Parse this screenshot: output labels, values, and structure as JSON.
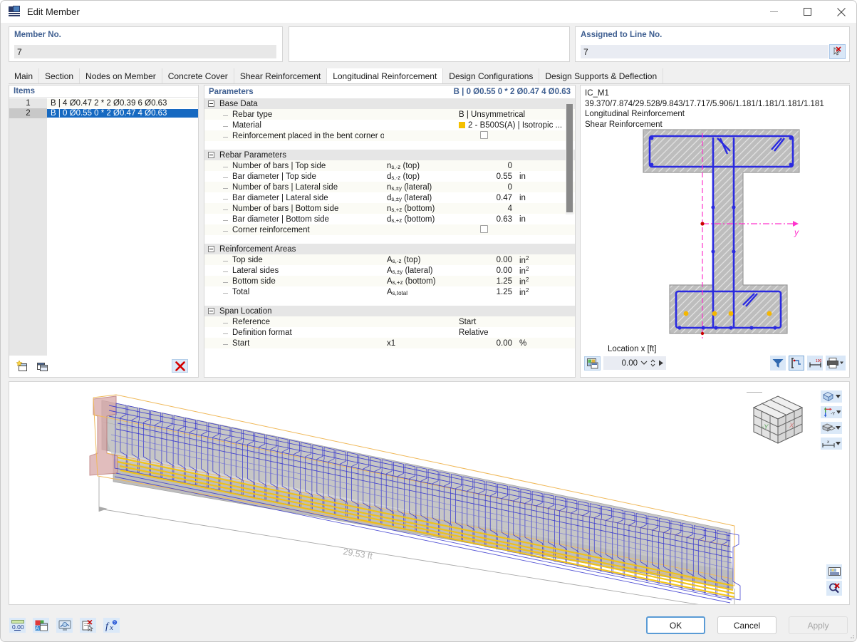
{
  "window": {
    "title": "Edit Member",
    "icon": "member-icon",
    "controls": {
      "minimize": "minimize-icon",
      "maximize": "maximize-icon",
      "close": "close-icon"
    }
  },
  "header": {
    "member": {
      "label": "Member No.",
      "value": "7"
    },
    "middle": {
      "label": "",
      "value": ""
    },
    "line": {
      "label": "Assigned to Line No.",
      "value": "7",
      "pick_icon": "pick-line-icon"
    }
  },
  "tabs": [
    {
      "label": "Main",
      "active": false
    },
    {
      "label": "Section",
      "active": false
    },
    {
      "label": "Nodes on Member",
      "active": false
    },
    {
      "label": "Concrete Cover",
      "active": false
    },
    {
      "label": "Shear Reinforcement",
      "active": false
    },
    {
      "label": "Longitudinal Reinforcement",
      "active": true
    },
    {
      "label": "Design Configurations",
      "active": false
    },
    {
      "label": "Design Supports & Deflection",
      "active": false
    }
  ],
  "items": {
    "header": "Items",
    "rows": [
      {
        "no": "1",
        "text": "B | 4 Ø0.47 2 * 2 Ø0.39 6 Ø0.63",
        "selected": false
      },
      {
        "no": "2",
        "text": "B | 0 Ø0.55 0 * 2 Ø0.47 4 Ø0.63",
        "selected": true
      }
    ],
    "toolbar": {
      "new_icon": "new-item-icon",
      "copy_icon": "copy-item-icon",
      "delete_icon": "delete-item-icon"
    }
  },
  "parameters": {
    "header": "Parameters",
    "header_value": "B | 0 Ø0.55 0 * 2 Ø0.47 4 Ø0.63",
    "groups": [
      {
        "name": "Base Data",
        "rows": [
          {
            "label": "Rebar type",
            "symbol": "",
            "value": "B | Unsymmetrical",
            "unit": "",
            "kind": "text-wide"
          },
          {
            "label": "Material",
            "symbol": "",
            "value": "2 - B500S(A) | Isotropic ...",
            "unit": "",
            "kind": "material",
            "swatch": "#f5c000"
          },
          {
            "label": "Reinforcement placed in the bent corner of t...",
            "symbol": "",
            "value": "",
            "unit": "",
            "kind": "checkbox",
            "checked": false
          }
        ]
      },
      {
        "name": "Rebar Parameters",
        "rows": [
          {
            "label": "Number of bars | Top side",
            "symbol": "n_s,-z (top)",
            "value": "0",
            "unit": "",
            "kind": "number"
          },
          {
            "label": "Bar diameter | Top side",
            "symbol": "d_s,-z (top)",
            "value": "0.55",
            "unit": "in",
            "kind": "number"
          },
          {
            "label": "Number of bars | Lateral side",
            "symbol": "n_s,±y (lateral)",
            "value": "0",
            "unit": "",
            "kind": "number"
          },
          {
            "label": "Bar diameter | Lateral side",
            "symbol": "d_s,±y (lateral)",
            "value": "0.47",
            "unit": "in",
            "kind": "number"
          },
          {
            "label": "Number of bars | Bottom side",
            "symbol": "n_s,+z (bottom)",
            "value": "4",
            "unit": "",
            "kind": "number"
          },
          {
            "label": "Bar diameter | Bottom side",
            "symbol": "d_s,+z (bottom)",
            "value": "0.63",
            "unit": "in",
            "kind": "number"
          },
          {
            "label": "Corner reinforcement",
            "symbol": "",
            "value": "",
            "unit": "",
            "kind": "checkbox",
            "checked": false
          }
        ]
      },
      {
        "name": "Reinforcement Areas",
        "rows": [
          {
            "label": "Top side",
            "symbol": "A_s,-z (top)",
            "value": "0.00",
            "unit": "in2",
            "kind": "number"
          },
          {
            "label": "Lateral sides",
            "symbol": "A_s,±y (lateral)",
            "value": "0.00",
            "unit": "in2",
            "kind": "number"
          },
          {
            "label": "Bottom side",
            "symbol": "A_s,+z (bottom)",
            "value": "1.25",
            "unit": "in2",
            "kind": "number"
          },
          {
            "label": "Total",
            "symbol": "A_s,total",
            "value": "1.25",
            "unit": "in2",
            "kind": "number"
          }
        ]
      },
      {
        "name": "Span Location",
        "rows": [
          {
            "label": "Reference",
            "symbol": "",
            "value": "Start",
            "unit": "",
            "kind": "text-wide"
          },
          {
            "label": "Definition format",
            "symbol": "",
            "value": "Relative",
            "unit": "",
            "kind": "text-wide"
          },
          {
            "label": "Start",
            "symbol": "x1",
            "value": "0.00",
            "unit": "%",
            "kind": "number"
          }
        ]
      }
    ]
  },
  "section_view": {
    "info_lines": [
      "IC_M1 39.370/7.874/29.528/9.843/17.717/5.906/1.181/1.181/1.181/1.181",
      "Longitudinal Reinforcement",
      "Shear Reinforcement"
    ],
    "axis_label": "y",
    "location": {
      "label": "Location x [ft]",
      "value": "0.00"
    },
    "buttons": {
      "image_icon": "save-image-icon",
      "filter_icon": "filter-icon",
      "section_icon": "section-properties-icon",
      "dimensions_icon": "dimensions-icon",
      "print_icon": "print-icon"
    }
  },
  "viewport": {
    "dimension_label": "29.53 ft",
    "navcube": {
      "face_left": "-Y",
      "face_right": "X"
    },
    "tools": [
      {
        "name": "render-mode-button",
        "icon": "cube-icon"
      },
      {
        "name": "axes-button",
        "icon": "axes-icon",
        "label": "-Y"
      },
      {
        "name": "view-layers-button",
        "icon": "layers-icon"
      },
      {
        "name": "dimension-button",
        "icon": "dimension-icon"
      }
    ],
    "bottom_tools": [
      {
        "name": "print-view-button",
        "icon": "print-view-icon"
      },
      {
        "name": "clear-selection-button",
        "icon": "clear-zoom-icon"
      }
    ]
  },
  "footer": {
    "tools": [
      {
        "name": "decimals-button",
        "icon": "decimal-places-icon"
      },
      {
        "name": "display-properties-button",
        "icon": "display-properties-icon"
      },
      {
        "name": "render-settings-button",
        "icon": "render-settings-icon"
      },
      {
        "name": "reset-button",
        "icon": "reset-selection-icon"
      },
      {
        "name": "formula-button",
        "icon": "formula-icon"
      }
    ],
    "buttons": {
      "ok": "OK",
      "cancel": "Cancel",
      "apply": "Apply"
    }
  },
  "colors": {
    "accent": "#3f5f91",
    "selection": "#1669c1",
    "rebar": "#2a2ae0",
    "concrete": "#bdbdbd",
    "material_swatch": "#f5c000",
    "axis": "#ff33cc"
  }
}
